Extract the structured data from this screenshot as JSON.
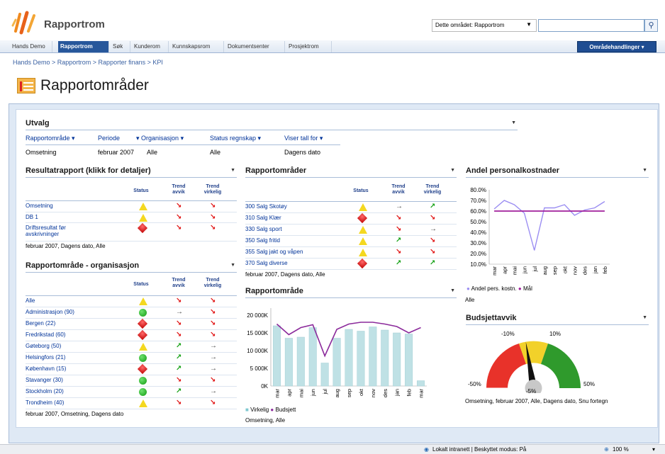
{
  "header": {
    "site_title": "Rapportrom",
    "scope_select": "Dette området: Rapportrom",
    "search_value": ""
  },
  "tabs": [
    "Hands Demo",
    "Rapportrom",
    "Søk",
    "Kunderom",
    "Kunnskapsrom",
    "Dokumentsenter",
    "Prosjektrom"
  ],
  "active_tab": "Rapportrom",
  "site_actions": "Områdehandlinger ▾",
  "breadcrumb": "Hands Demo > Rapportrom > Rapporter finans > KPI",
  "page_title": "Rapportområder",
  "utvalg": {
    "title": "Utvalg",
    "filters": [
      "Rapportområde",
      "Periode",
      "Organisasjon",
      "Status regnskap",
      "Viser tall for"
    ],
    "values": [
      "Omsetning",
      "februar 2007",
      "Alle",
      "Alle",
      "Dagens dato"
    ]
  },
  "resultat": {
    "title": "Resultatrapport (klikk for detaljer)",
    "col_status": "Status",
    "col_trend_avvik": "Trend avvik",
    "col_trend_virkelig": "Trend virkelig",
    "rows": [
      {
        "label": "Omsetning",
        "status": "yellow",
        "avvik": "down",
        "virkelig": "down"
      },
      {
        "label": "DB 1",
        "status": "yellow",
        "avvik": "down",
        "virkelig": "down"
      },
      {
        "label": "Driftsresultat før avskrivninger",
        "status": "red",
        "avvik": "down",
        "virkelig": "down"
      }
    ],
    "footer": "februar 2007, Dagens dato, Alle"
  },
  "org": {
    "title": "Rapportområde - organisasjon",
    "col_status": "Status",
    "col_trend_avvik": "Trend avvik",
    "col_trend_virkelig": "Trend virkelig",
    "rows": [
      {
        "label": "Alle",
        "status": "yellow",
        "avvik": "down",
        "virkelig": "down"
      },
      {
        "label": "Administrasjon (90)",
        "status": "green",
        "avvik": "flat",
        "virkelig": "down"
      },
      {
        "label": "Bergen (22)",
        "status": "red",
        "avvik": "down",
        "virkelig": "down"
      },
      {
        "label": "Fredrikstad (60)",
        "status": "red",
        "avvik": "down",
        "virkelig": "down"
      },
      {
        "label": "Gøteborg (50)",
        "status": "yellow",
        "avvik": "up",
        "virkelig": "flat"
      },
      {
        "label": "Helsingfors (21)",
        "status": "green",
        "avvik": "up",
        "virkelig": "flat"
      },
      {
        "label": "København (15)",
        "status": "red",
        "avvik": "up",
        "virkelig": "flat"
      },
      {
        "label": "Stavanger (30)",
        "status": "green",
        "avvik": "down",
        "virkelig": "down"
      },
      {
        "label": "Stockholm (20)",
        "status": "green",
        "avvik": "up",
        "virkelig": "flat"
      },
      {
        "label": "Trondheim (40)",
        "status": "yellow",
        "avvik": "down",
        "virkelig": "down"
      }
    ],
    "footer": "februar 2007, Omsetning, Dagens dato"
  },
  "omrader": {
    "title": "Rapportområder",
    "col_status": "Status",
    "col_trend_avvik": "Trend avvik",
    "col_trend_virkelig": "Trend virkelig",
    "rows": [
      {
        "label": "300 Salg Skotøy",
        "status": "yellow",
        "avvik": "flat",
        "virkelig": "up"
      },
      {
        "label": "310 Salg Klær",
        "status": "red",
        "avvik": "down",
        "virkelig": "down"
      },
      {
        "label": "330 Salg sport",
        "status": "yellow",
        "avvik": "down",
        "virkelig": "flat"
      },
      {
        "label": "350 Salg fritid",
        "status": "yellow",
        "avvik": "up",
        "virkelig": "down"
      },
      {
        "label": "355 Salg jakt og våpen",
        "status": "yellow",
        "avvik": "down",
        "virkelig": "down"
      },
      {
        "label": "370 Salg diverse",
        "status": "red",
        "avvik": "up",
        "virkelig": "up"
      }
    ],
    "footer": "februar 2007, Dagens dato, Alle"
  },
  "bar_chart_panel": {
    "title": "Rapportområde",
    "legend": [
      "Virkelig",
      "Budsjett"
    ],
    "footer": "Omsetning, Alle"
  },
  "line_chart_panel": {
    "title": "Andel personalkostnader",
    "legend": [
      "Andel pers. kostn.",
      "Mål"
    ],
    "footer": "Alle"
  },
  "gauge_panel": {
    "title": "Budsjettavvik",
    "labels": [
      "-10%",
      "10%",
      "-50%",
      "50%",
      "-5%"
    ],
    "footer": "Omsetning, februar 2007, Alle, Dagens dato, Snu fortegn"
  },
  "gauge_value": -5,
  "status_bar": {
    "zone": "Lokalt intranett | Beskyttet modus: På",
    "zoom": "100 %"
  },
  "colors": {
    "tab_active": "#27579b",
    "virkelig_bar": "#bfe1e5",
    "budsjett_line": "#8b2a9b",
    "andel_line": "#9b8ef2",
    "mal_line": "#a01f9c",
    "gauge_red": "#e8322a",
    "gauge_yellow": "#f2d12a",
    "gauge_green": "#2f9a2c"
  },
  "chart_data": [
    {
      "type": "bar",
      "title": "Rapportområde",
      "categories": [
        "mar",
        "apr",
        "mai",
        "jun",
        "jul",
        "aug",
        "sep",
        "okt",
        "nov",
        "des",
        "jan",
        "feb",
        "mar"
      ],
      "series": [
        {
          "name": "Virkelig",
          "type": "bar",
          "values": [
            17000,
            13500,
            13800,
            16500,
            6500,
            13500,
            16000,
            15500,
            16700,
            15800,
            15000,
            14700,
            1500
          ]
        },
        {
          "name": "Budsjett",
          "type": "line",
          "values": [
            17500,
            14500,
            16500,
            17300,
            8500,
            16000,
            17500,
            18000,
            18000,
            17500,
            16800,
            15000,
            16500
          ]
        }
      ],
      "ylim": [
        0,
        22000
      ],
      "yticks": [
        "0K",
        "5 000K",
        "10 000K",
        "15 000K",
        "20 000K"
      ]
    },
    {
      "type": "line",
      "title": "Andel personalkostnader",
      "categories": [
        "mar",
        "apr",
        "mai",
        "jun",
        "jul",
        "aug",
        "sep",
        "okt",
        "nov",
        "des",
        "jan",
        "feb"
      ],
      "series": [
        {
          "name": "Andel pers. kostn.",
          "values": [
            62,
            70,
            66,
            58,
            23,
            63,
            63,
            66,
            56,
            61,
            63,
            69
          ]
        },
        {
          "name": "Mål",
          "values": [
            60,
            60,
            60,
            60,
            60,
            60,
            60,
            60,
            60,
            60,
            60,
            60
          ]
        }
      ],
      "ylim": [
        10,
        80
      ],
      "yticks": [
        "10.0%",
        "20.0%",
        "30.0%",
        "40.0%",
        "50.0%",
        "60.0%",
        "70.0%",
        "80.0%"
      ]
    }
  ]
}
